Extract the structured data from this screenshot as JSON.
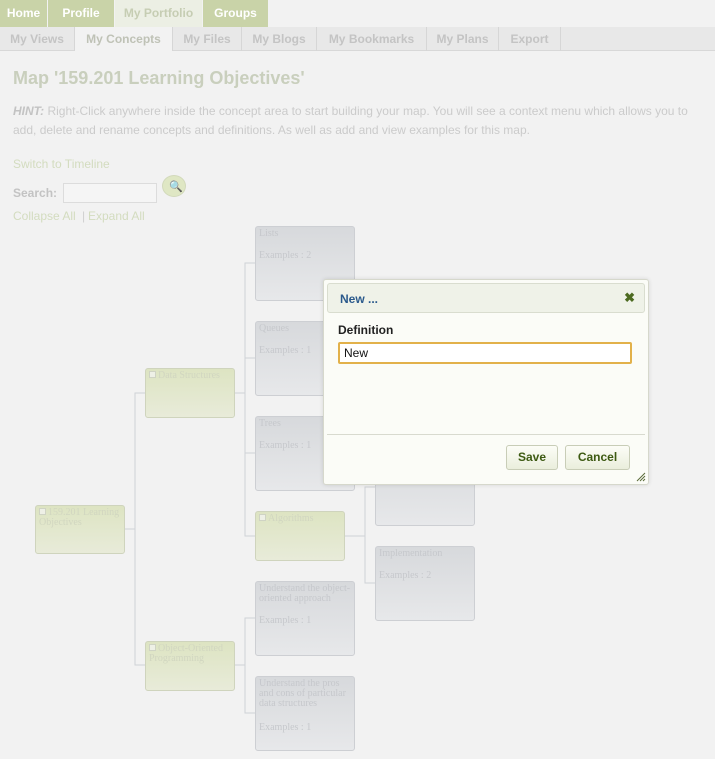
{
  "topnav": {
    "tabs": [
      {
        "label": "Home"
      },
      {
        "label": "Profile"
      },
      {
        "label": "My Portfolio"
      },
      {
        "label": "Groups"
      }
    ]
  },
  "subnav": {
    "tabs": [
      {
        "label": "My Views"
      },
      {
        "label": "My Concepts"
      },
      {
        "label": "My Files"
      },
      {
        "label": "My Blogs"
      },
      {
        "label": "My Bookmarks"
      },
      {
        "label": "My Plans"
      },
      {
        "label": "Export"
      }
    ]
  },
  "page": {
    "title": "Map '159.201 Learning Objectives'",
    "hint_label": "HINT:",
    "hint_text": "Right-Click anywhere inside the concept area to start building your map. You will see a context menu which allows you to add, delete and rename concepts and definitions. As well as add and view examples for this map.",
    "switch_link": "Switch to Timeline",
    "search_label": "Search:",
    "search_value": "",
    "collapse_all": "Collapse All",
    "separator": "|",
    "expand_all": "Expand All"
  },
  "map": {
    "root": {
      "label": "159.201 Learning Objectives"
    },
    "data_structures": {
      "label": "Data Structures"
    },
    "oop": {
      "label": "Object-Oriented Programming"
    },
    "lists": {
      "label": "Lists",
      "examples": "Examples : 2"
    },
    "queues": {
      "label": "Queues",
      "examples": "Examples : 1"
    },
    "trees": {
      "label": "Trees",
      "examples": "Examples : 1"
    },
    "algorithms": {
      "label": "Algorithms"
    },
    "implementation": {
      "label": "Implementation",
      "examples": "Examples : 2"
    },
    "understand_oo": {
      "label": "Understand the object-oriented approach",
      "examples": "Examples : 1"
    },
    "understand_pros": {
      "label": "Understand the pros and cons of particular data structures",
      "examples": "Examples : 1"
    }
  },
  "dialog": {
    "title": "New ...",
    "field_label": "Definition",
    "field_value": "New ",
    "save_label": "Save",
    "cancel_label": "Cancel"
  }
}
